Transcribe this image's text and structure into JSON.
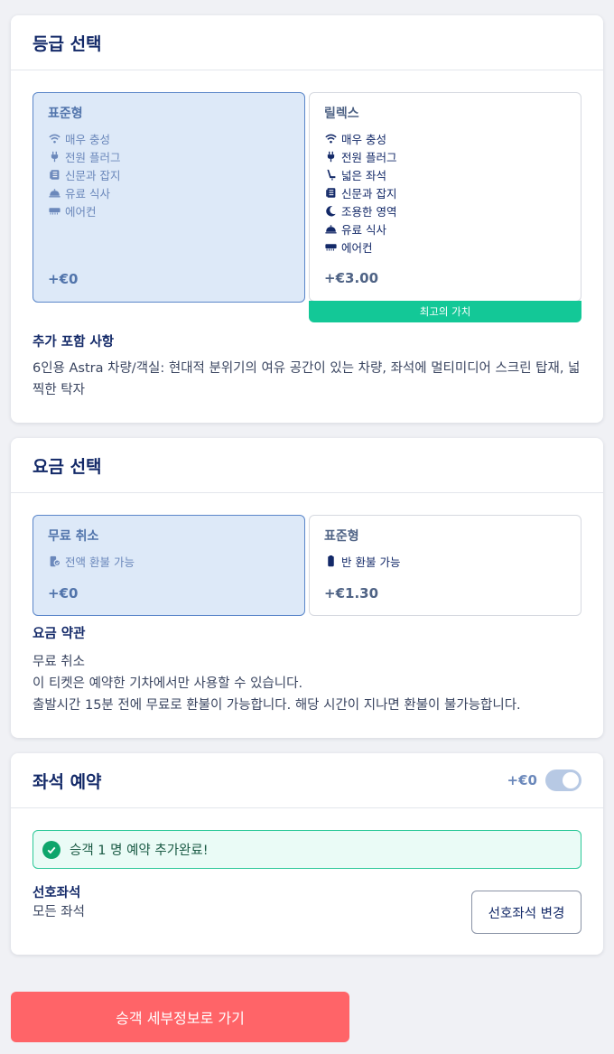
{
  "class_section": {
    "title": "등급 선택",
    "options": [
      {
        "name": "표준형",
        "features": [
          {
            "icon": "wifi-icon",
            "label": "매우 충성"
          },
          {
            "icon": "plug-icon",
            "label": "전원 플러그"
          },
          {
            "icon": "newspaper-icon",
            "label": "신문과 잡지"
          },
          {
            "icon": "meal-icon",
            "label": "유료 식사"
          },
          {
            "icon": "air-conditioner-icon",
            "label": "에어컨"
          }
        ],
        "price": "+€0",
        "selected": true
      },
      {
        "name": "릴렉스",
        "features": [
          {
            "icon": "wifi-icon",
            "label": "매우 충성"
          },
          {
            "icon": "plug-icon",
            "label": "전원 플러그"
          },
          {
            "icon": "seat-icon",
            "label": "넓은 좌석"
          },
          {
            "icon": "newspaper-icon",
            "label": "신문과 잡지"
          },
          {
            "icon": "moon-icon",
            "label": "조용한 영역"
          },
          {
            "icon": "meal-icon",
            "label": "유료 식사"
          },
          {
            "icon": "air-conditioner-icon",
            "label": "에어컨"
          }
        ],
        "price": "+€3.00",
        "badge": "최고의 가치",
        "selected": false
      }
    ],
    "extra_title": "추가 포함 사항",
    "extra_text": "6인용 Astra 차량/객실: 현대적 분위기의 여유 공간이 있는 차량, 좌석에 멀티미디어 스크린 탑재, 넓찍한 탁자"
  },
  "fare_section": {
    "title": "요금 선택",
    "options": [
      {
        "name": "무료 취소",
        "feature": {
          "icon": "refund-icon",
          "label": "전액 환불 가능"
        },
        "price": "+€0",
        "selected": true
      },
      {
        "name": "표준형",
        "feature": {
          "icon": "half-refund-icon",
          "label": "반 환불 가능"
        },
        "price": "+€1.30",
        "selected": false
      }
    ],
    "terms_title": "요금 약관",
    "terms_lines": [
      "무료 취소",
      "이 티켓은 예약한 기차에서만 사용할 수 있습니다.",
      "출발시간 15분 전에 무료로 환불이 가능합니다. 해당 시간이 지나면 환불이 불가능합니다."
    ]
  },
  "seat_section": {
    "title": "좌석 예약",
    "price": "+€0",
    "toggle_on": true,
    "alert": "승객 1 명 예약 추가완료!",
    "pref_label": "선호좌석",
    "pref_value": "모든 좌석",
    "change_button": "선호좌석 변경"
  },
  "continue_button": "승객 세부정보로 가기",
  "colors": {
    "navy": "#132968",
    "selected_bg": "#dde9f8",
    "selected_border": "#5a86c9",
    "badge_green": "#13c897",
    "primary_button": "#ff6468"
  }
}
